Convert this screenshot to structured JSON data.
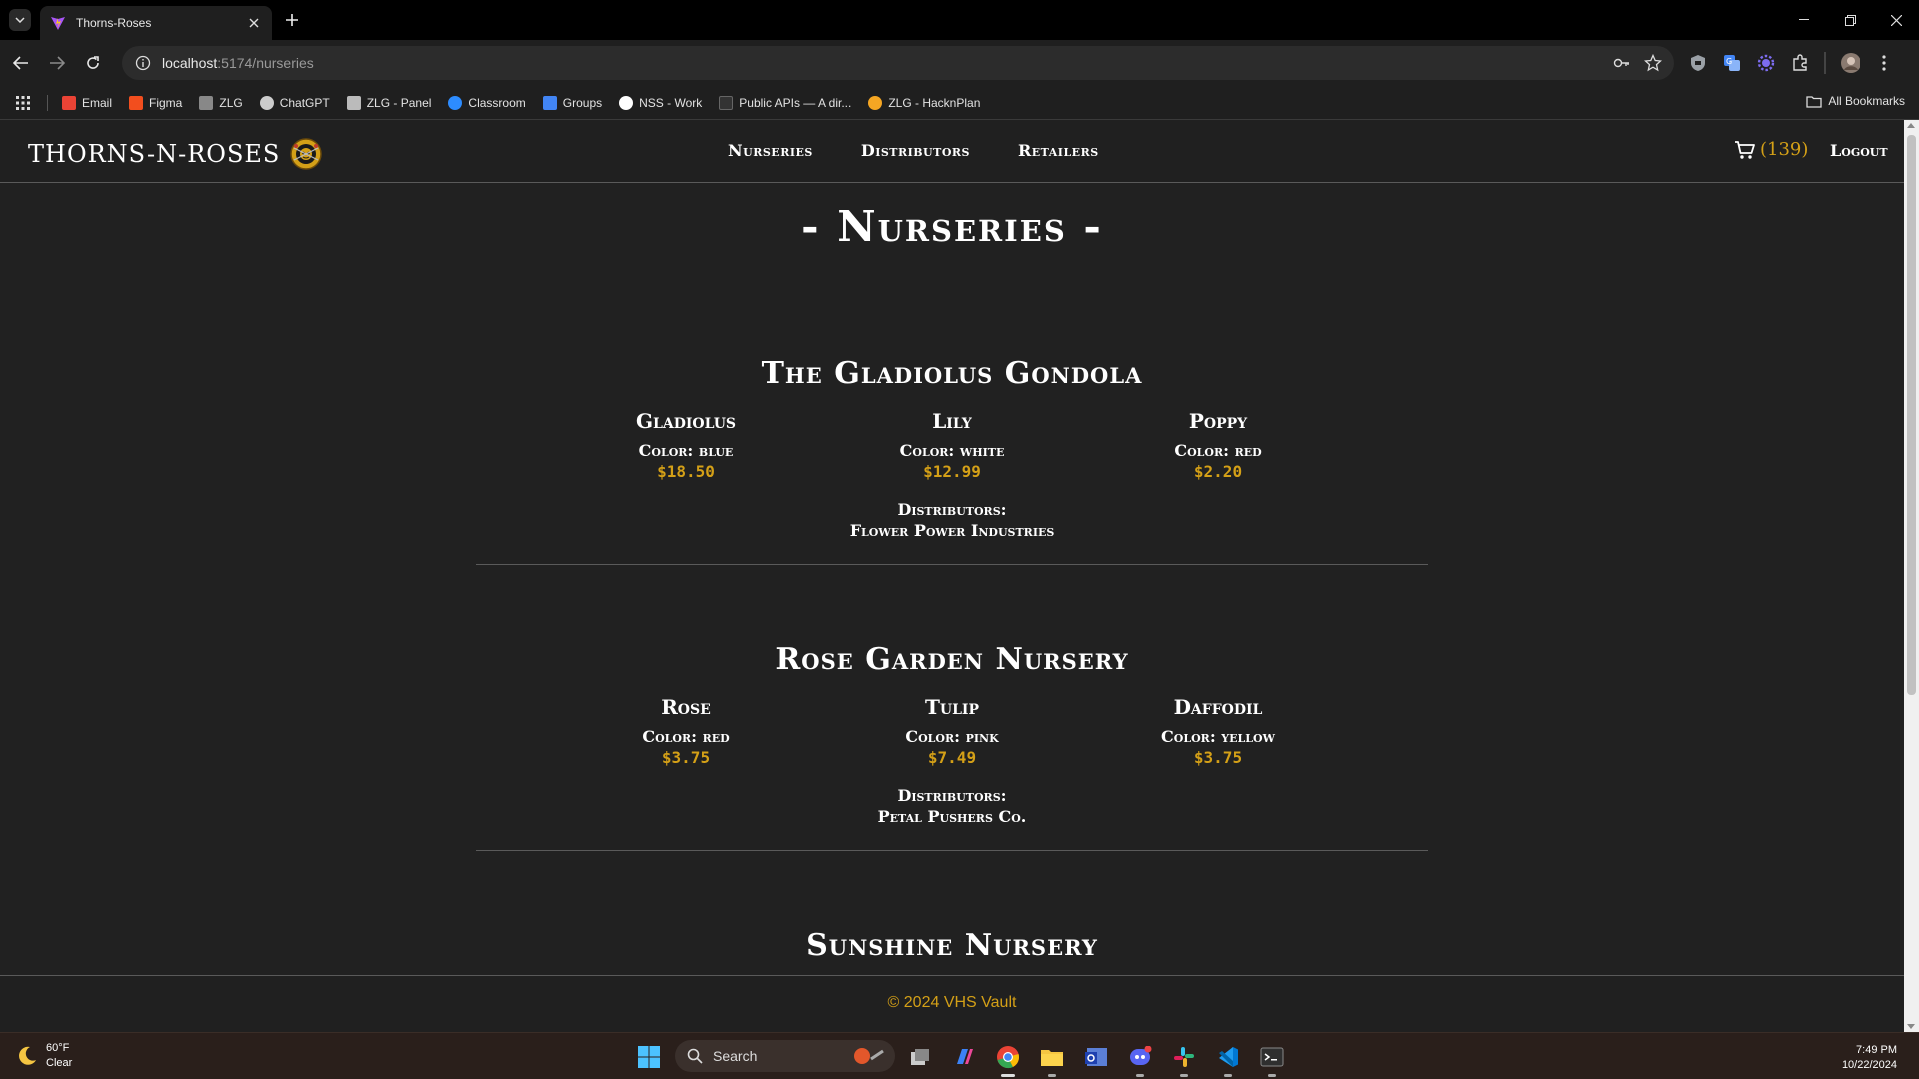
{
  "browser": {
    "tab_title": "Thorns-Roses",
    "url_host": "localhost",
    "url_path": ":5174/nurseries",
    "bookmarks": [
      {
        "label": "Email",
        "color": "#ea4335"
      },
      {
        "label": "Figma",
        "color": "#f24e1e"
      },
      {
        "label": "ZLG",
        "color": "#888888"
      },
      {
        "label": "ChatGPT",
        "color": "#cccccc"
      },
      {
        "label": "ZLG - Panel",
        "color": "#bbbbbb"
      },
      {
        "label": "Classroom",
        "color": "#2d8cff"
      },
      {
        "label": "Groups",
        "color": "#4285f4"
      },
      {
        "label": "NSS - Work",
        "color": "#ffffff"
      },
      {
        "label": "Public APIs — A dir...",
        "color": "#333333"
      },
      {
        "label": "ZLG - HacknPlan",
        "color": "#f5a623"
      }
    ],
    "all_bookmarks": "All Bookmarks"
  },
  "site": {
    "brand": "THORNS-N-ROSES",
    "nav": [
      "Nurseries",
      "Distributors",
      "Retailers"
    ],
    "cart_count": "(139)",
    "logout": "Logout",
    "page_title": "- Nurseries -",
    "footer": "© 2024 VHS Vault",
    "accent_color": "#d4a017"
  },
  "nurseries": [
    {
      "name": "The Gladiolus Gondola",
      "flowers": [
        {
          "name": "Gladiolus",
          "color": "Color: blue",
          "price": "$18.50"
        },
        {
          "name": "Lily",
          "color": "Color: white",
          "price": "$12.99"
        },
        {
          "name": "Poppy",
          "color": "Color: red",
          "price": "$2.20"
        }
      ],
      "distributors_label": "Distributors:",
      "distributors": "Flower Power Industries"
    },
    {
      "name": "Rose Garden Nursery",
      "flowers": [
        {
          "name": "Rose",
          "color": "Color: red",
          "price": "$3.75"
        },
        {
          "name": "Tulip",
          "color": "Color: pink",
          "price": "$7.49"
        },
        {
          "name": "Daffodil",
          "color": "Color: yellow",
          "price": "$3.75"
        }
      ],
      "distributors_label": "Distributors:",
      "distributors": "Petal Pushers Co."
    },
    {
      "name": "Sunshine Nursery"
    }
  ],
  "taskbar": {
    "weather_temp": "60°F",
    "weather_desc": "Clear",
    "search_placeholder": "Search",
    "time": "7:49 PM",
    "date": "10/22/2024"
  }
}
